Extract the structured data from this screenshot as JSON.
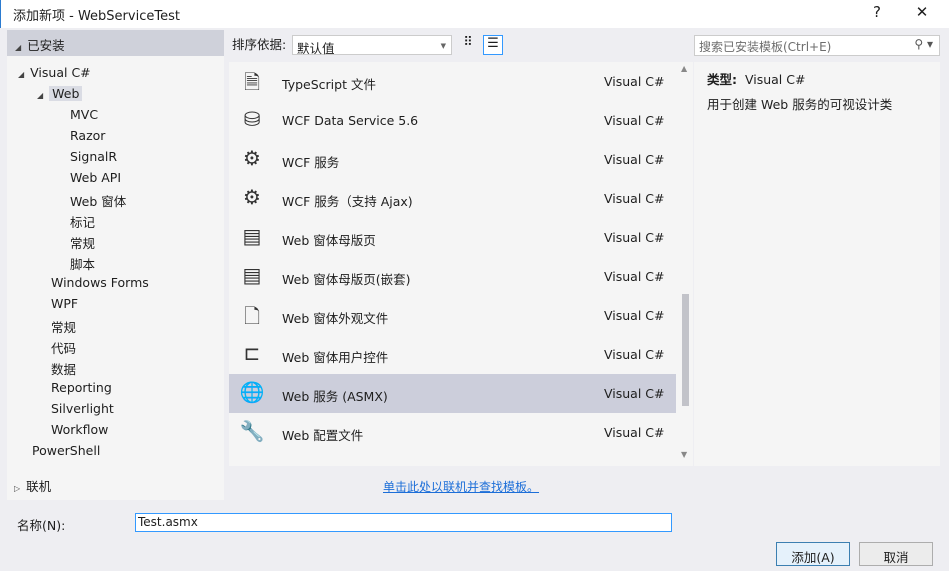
{
  "window": {
    "title": "添加新项 - WebServiceTest",
    "help": "?",
    "close": "✕"
  },
  "sidebar": {
    "installed": "已安装",
    "tree": [
      {
        "label": "Visual C#",
        "level": 0,
        "expanded": true
      },
      {
        "label": "Web",
        "level": 1,
        "expanded": true,
        "selected": true
      },
      {
        "label": "MVC",
        "level": 2
      },
      {
        "label": "Razor",
        "level": 2
      },
      {
        "label": "SignalR",
        "level": 2
      },
      {
        "label": "Web API",
        "level": 2
      },
      {
        "label": "Web 窗体",
        "level": 2
      },
      {
        "label": "标记",
        "level": 2
      },
      {
        "label": "常规",
        "level": 2
      },
      {
        "label": "脚本",
        "level": 2
      },
      {
        "label": "Windows Forms",
        "level": 1
      },
      {
        "label": "WPF",
        "level": 1
      },
      {
        "label": "常规",
        "level": 1
      },
      {
        "label": "代码",
        "level": 1
      },
      {
        "label": "数据",
        "level": 1
      },
      {
        "label": "Reporting",
        "level": 1
      },
      {
        "label": "Silverlight",
        "level": 1
      },
      {
        "label": "Workflow",
        "level": 1
      },
      {
        "label": "PowerShell",
        "level": 0
      }
    ],
    "online": "联机"
  },
  "toolbar": {
    "sort_label": "排序依据:",
    "sort_value": "默认值"
  },
  "templates": [
    {
      "name": "TypeScript 文件",
      "lang": "Visual C#",
      "icon": "typescript-file-icon"
    },
    {
      "name": "WCF Data Service 5.6",
      "lang": "Visual C#",
      "icon": "data-service-icon"
    },
    {
      "name": "WCF 服务",
      "lang": "Visual C#",
      "icon": "wcf-service-icon"
    },
    {
      "name": "WCF 服务（支持 Ajax)",
      "lang": "Visual C#",
      "icon": "wcf-service-icon"
    },
    {
      "name": "Web 窗体母版页",
      "lang": "Visual C#",
      "icon": "master-page-icon"
    },
    {
      "name": "Web 窗体母版页(嵌套)",
      "lang": "Visual C#",
      "icon": "master-page-icon"
    },
    {
      "name": "Web 窗体外观文件",
      "lang": "Visual C#",
      "icon": "skin-file-icon"
    },
    {
      "name": "Web 窗体用户控件",
      "lang": "Visual C#",
      "icon": "user-control-icon"
    },
    {
      "name": "Web 服务 (ASMX)",
      "lang": "Visual C#",
      "icon": "web-service-icon",
      "selected": true
    },
    {
      "name": "Web 配置文件",
      "lang": "Visual C#",
      "icon": "config-file-icon"
    }
  ],
  "search": {
    "placeholder": "搜索已安装模板(Ctrl+E)"
  },
  "details": {
    "type_label": "类型:",
    "type_value": "Visual C#",
    "description": "用于创建 Web 服务的可视设计类"
  },
  "online_link": "单击此处以联机并查找模板。",
  "form": {
    "name_label": "名称(N):",
    "name_value": "Test.asmx"
  },
  "buttons": {
    "add": "添加(A)",
    "cancel": "取消"
  }
}
